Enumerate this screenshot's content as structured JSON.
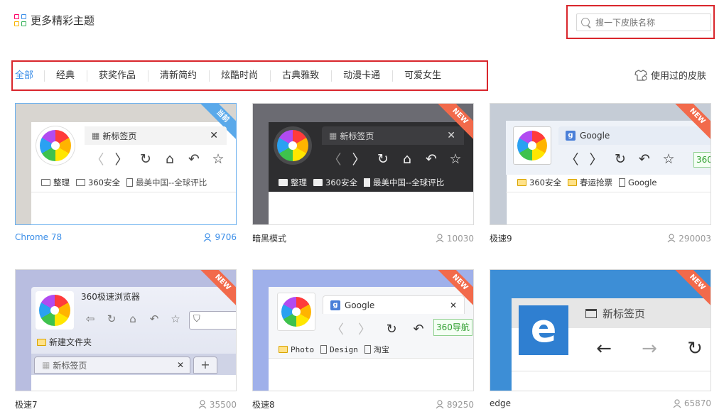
{
  "header": {
    "title": "更多精彩主题"
  },
  "search": {
    "placeholder": "搜一下皮肤名称"
  },
  "tabs": [
    {
      "label": "全部",
      "active": true
    },
    {
      "label": "经典"
    },
    {
      "label": "获奖作品"
    },
    {
      "label": "清新简约"
    },
    {
      "label": "炫酷时尚"
    },
    {
      "label": "古典雅致"
    },
    {
      "label": "动漫卡通"
    },
    {
      "label": "可爱女生"
    }
  ],
  "used_skins": {
    "label": "使用过的皮肤"
  },
  "themes": [
    {
      "name": "Chrome 78",
      "count": "9706",
      "badge": "当前",
      "preview": {
        "tab_title": "新标签页",
        "bookmarks": [
          "整理",
          "360安全",
          "最美中国--全球评比"
        ]
      }
    },
    {
      "name": "暗黑模式",
      "count": "10030",
      "badge": "NEW",
      "preview": {
        "tab_title": "新标签页",
        "bookmarks": [
          "整理",
          "360安全",
          "最美中国--全球评比"
        ]
      }
    },
    {
      "name": "极速9",
      "count": "290003",
      "badge": "NEW",
      "preview": {
        "tab_title": "Google",
        "address": "360",
        "bookmarks": [
          "360安全",
          "春运抢票",
          "Google"
        ]
      }
    },
    {
      "name": "极速7",
      "count": "35500",
      "badge": "NEW",
      "preview": {
        "window_title": "360极速浏览器",
        "folder": "新建文件夹",
        "tab_title": "新标签页"
      }
    },
    {
      "name": "极速8",
      "count": "89250",
      "badge": "NEW",
      "preview": {
        "tab_title": "Google",
        "address": "360导航",
        "bookmarks": [
          "Photo",
          "Design",
          "淘宝"
        ]
      }
    },
    {
      "name": "edge",
      "count": "65870",
      "badge": "NEW",
      "preview": {
        "tab_title": "新标签页"
      }
    }
  ],
  "colors": {
    "accent": "#3b8ee8",
    "highlight_border": "#d9262c",
    "new_ribbon": "#f26a4b",
    "current_ribbon": "#5aa9ea"
  }
}
